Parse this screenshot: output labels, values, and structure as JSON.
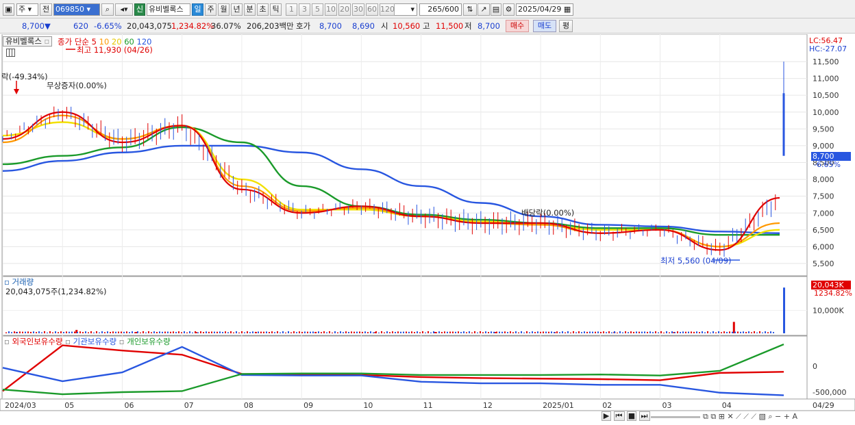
{
  "toolbar": {
    "type_label": "주",
    "prev_label": "전",
    "code": "069850",
    "stock_badge": "신",
    "stock_name": "유비벨록스",
    "periods": [
      "일",
      "주",
      "월",
      "년",
      "분",
      "초",
      "틱"
    ],
    "active_period": "일",
    "intervals": [
      "1",
      "3",
      "5",
      "10",
      "20",
      "30",
      "60",
      "120"
    ],
    "count": "265",
    "count_total": "/600",
    "date": "2025/04/29"
  },
  "quote": {
    "price": "8,700",
    "down_arrow": "▼",
    "change": "620",
    "change_pct": "-6.65%",
    "volume": "20,043,075",
    "volume_pct": "1,234.82%",
    "turnover": "36.07%",
    "amount": "206,203백만",
    "bid_label": "호가",
    "bid1": "8,700",
    "bid2": "8,690",
    "open_label": "시",
    "open": "10,560",
    "high_label": "고",
    "high": "11,500",
    "low_label": "저",
    "low": "8,700",
    "buy_label": "매수",
    "sell_label": "매도",
    "avg_label": "평"
  },
  "price_panel": {
    "name_tag": "유비벨록스",
    "legend_prefix": "종가 단순",
    "ma_labels": [
      "5",
      "10",
      "20",
      "60",
      "120"
    ],
    "ma_colors": [
      "#e00000",
      "#ff9900",
      "#f2e000",
      "#1a9a2a",
      "#2856e0"
    ],
    "lc": "LC:56.47",
    "hc": "HC:-27.07",
    "annot_high": "최고 11,930 (04/26)",
    "annot_drop": "락(-49.34%)",
    "annot_bonus": "무상증자(0.00%)",
    "annot_dividend": "배당락(0.00%)",
    "annot_low": "최저 5,560 (04/09)",
    "current_price": "8,700",
    "current_pct": "-6.65%",
    "y_ticks": [
      "11,500",
      "11,000",
      "10,500",
      "10,000",
      "9,500",
      "9,000",
      "8,500",
      "8,000",
      "7,500",
      "7,000",
      "6,500",
      "6,000",
      "5,500"
    ]
  },
  "volume_panel": {
    "title": "거래량",
    "info": "20,043,075주(1,234.82%)",
    "current": "20,043K",
    "current_pct": "1234.82%",
    "y_tick": "10,000K"
  },
  "holders_panel": {
    "labels": [
      "외국인보유수량",
      "기관보유수량",
      "개인보유수량"
    ],
    "colors": [
      "#e00000",
      "#2856e0",
      "#1a9a2a"
    ],
    "y_ticks": [
      "0",
      "-500,000"
    ]
  },
  "x_axis": [
    "2024/03",
    "05",
    "06",
    "07",
    "08",
    "09",
    "10",
    "11",
    "12",
    "2025/01",
    "02",
    "03",
    "04"
  ],
  "x_axis_right": "04/29",
  "chart_data": [
    {
      "type": "line",
      "title": "유비벨록스 종가 단순",
      "x": [
        "2024/03",
        "05",
        "06",
        "07",
        "08",
        "09",
        "10",
        "11",
        "12",
        "2025/01",
        "02",
        "03",
        "04",
        "04/29"
      ],
      "series": [
        {
          "name": "5",
          "values": [
            9200,
            10000,
            9100,
            9600,
            7700,
            7000,
            7200,
            6900,
            6700,
            6700,
            6400,
            6500,
            5900,
            7450
          ]
        },
        {
          "name": "10",
          "values": [
            9100,
            9900,
            9200,
            9600,
            7800,
            7050,
            7150,
            6900,
            6700,
            6650,
            6400,
            6500,
            6000,
            6700
          ]
        },
        {
          "name": "20",
          "values": [
            9300,
            9700,
            9200,
            9600,
            8000,
            7100,
            7100,
            6900,
            6750,
            6650,
            6500,
            6500,
            6000,
            6500
          ]
        },
        {
          "name": "60",
          "values": [
            8450,
            8700,
            8950,
            9550,
            9100,
            7800,
            7200,
            6950,
            6800,
            6700,
            6550,
            6550,
            6350,
            6350
          ]
        },
        {
          "name": "120",
          "values": [
            8250,
            8550,
            8800,
            9000,
            9000,
            8800,
            8300,
            7800,
            7300,
            6900,
            6650,
            6600,
            6450,
            6400
          ]
        }
      ],
      "ylim": [
        5300,
        11900
      ]
    },
    {
      "type": "bar",
      "title": "거래량",
      "categories": [
        "2024/03",
        "05",
        "06",
        "07",
        "08",
        "09",
        "10",
        "11",
        "12",
        "2025/01",
        "02",
        "03",
        "04",
        "04/29"
      ],
      "values": [
        300,
        1500,
        200,
        300,
        300,
        200,
        150,
        150,
        150,
        300,
        150,
        200,
        5000,
        20043
      ],
      "ylim": [
        0,
        21000
      ]
    },
    {
      "type": "line",
      "title": "",
      "x": [
        "2024/03",
        "05",
        "06",
        "07",
        "08",
        "09",
        "10",
        "11",
        "12",
        "2025/01",
        "02",
        "03",
        "04",
        "04/29"
      ],
      "series": [
        {
          "name": "외국인보유수량",
          "values": [
            -480000,
            400000,
            300000,
            220000,
            -150000,
            -160000,
            -170000,
            -210000,
            -230000,
            -240000,
            -250000,
            -270000,
            -130000,
            -110000
          ]
        },
        {
          "name": "기관보유수량",
          "values": [
            -30000,
            -290000,
            -120000,
            370000,
            -170000,
            -180000,
            -180000,
            -300000,
            -330000,
            -330000,
            -360000,
            -360000,
            -510000,
            -560000
          ]
        },
        {
          "name": "개인보유수량",
          "values": [
            -450000,
            -540000,
            -500000,
            -480000,
            -150000,
            -140000,
            -140000,
            -170000,
            -170000,
            -170000,
            -160000,
            -180000,
            -90000,
            420000
          ]
        }
      ],
      "ylim": [
        -650000,
        500000
      ]
    }
  ]
}
